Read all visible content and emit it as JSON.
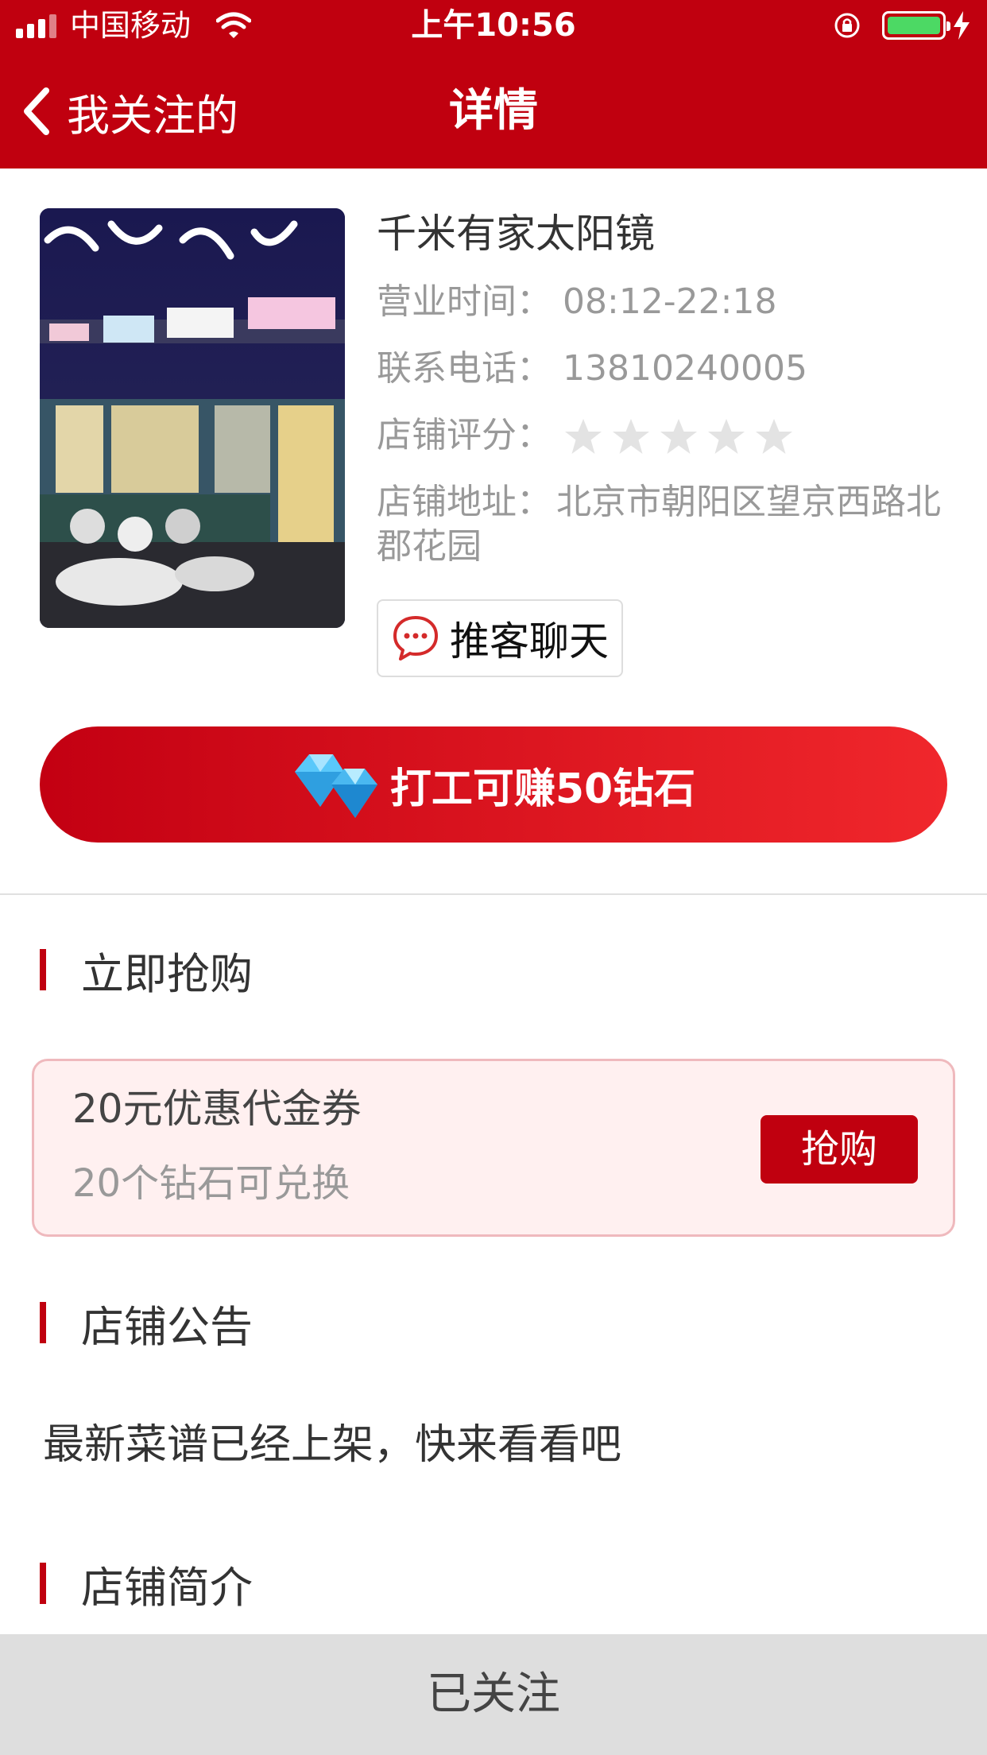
{
  "status_bar": {
    "carrier": "中国移动",
    "time": "上午10:56",
    "battery_color": "#4cd964"
  },
  "nav": {
    "back_label": "我关注的",
    "title": "详情"
  },
  "store": {
    "name": "千米有家太阳镜",
    "hours_label": "营业时间：",
    "hours_value": "08:12-22:18",
    "phone_label": "联系电话：",
    "phone_value": "13810240005",
    "rating_label": "店铺评分：",
    "rating_value": 0,
    "rating_max": 5,
    "address_label": "店铺地址：",
    "address_value": "北京市朝阳区望京西路北郡花园",
    "chat_label": "推客聊天"
  },
  "earn_button": {
    "label": "打工可赚50钻石"
  },
  "flash_sale": {
    "title": "立即抢购",
    "coupon_title": "20元优惠代金券",
    "coupon_subtitle": "20个钻石可兑换",
    "buy_label": "抢购"
  },
  "announcement": {
    "title": "店铺公告",
    "text": "最新菜谱已经上架，快来看看吧"
  },
  "intro": {
    "title": "店铺简介"
  },
  "follow_button": {
    "label": "已关注"
  },
  "colors": {
    "accent": "#c0000f",
    "coupon_bg": "#fff0f0",
    "footer_bg": "#dedede"
  }
}
